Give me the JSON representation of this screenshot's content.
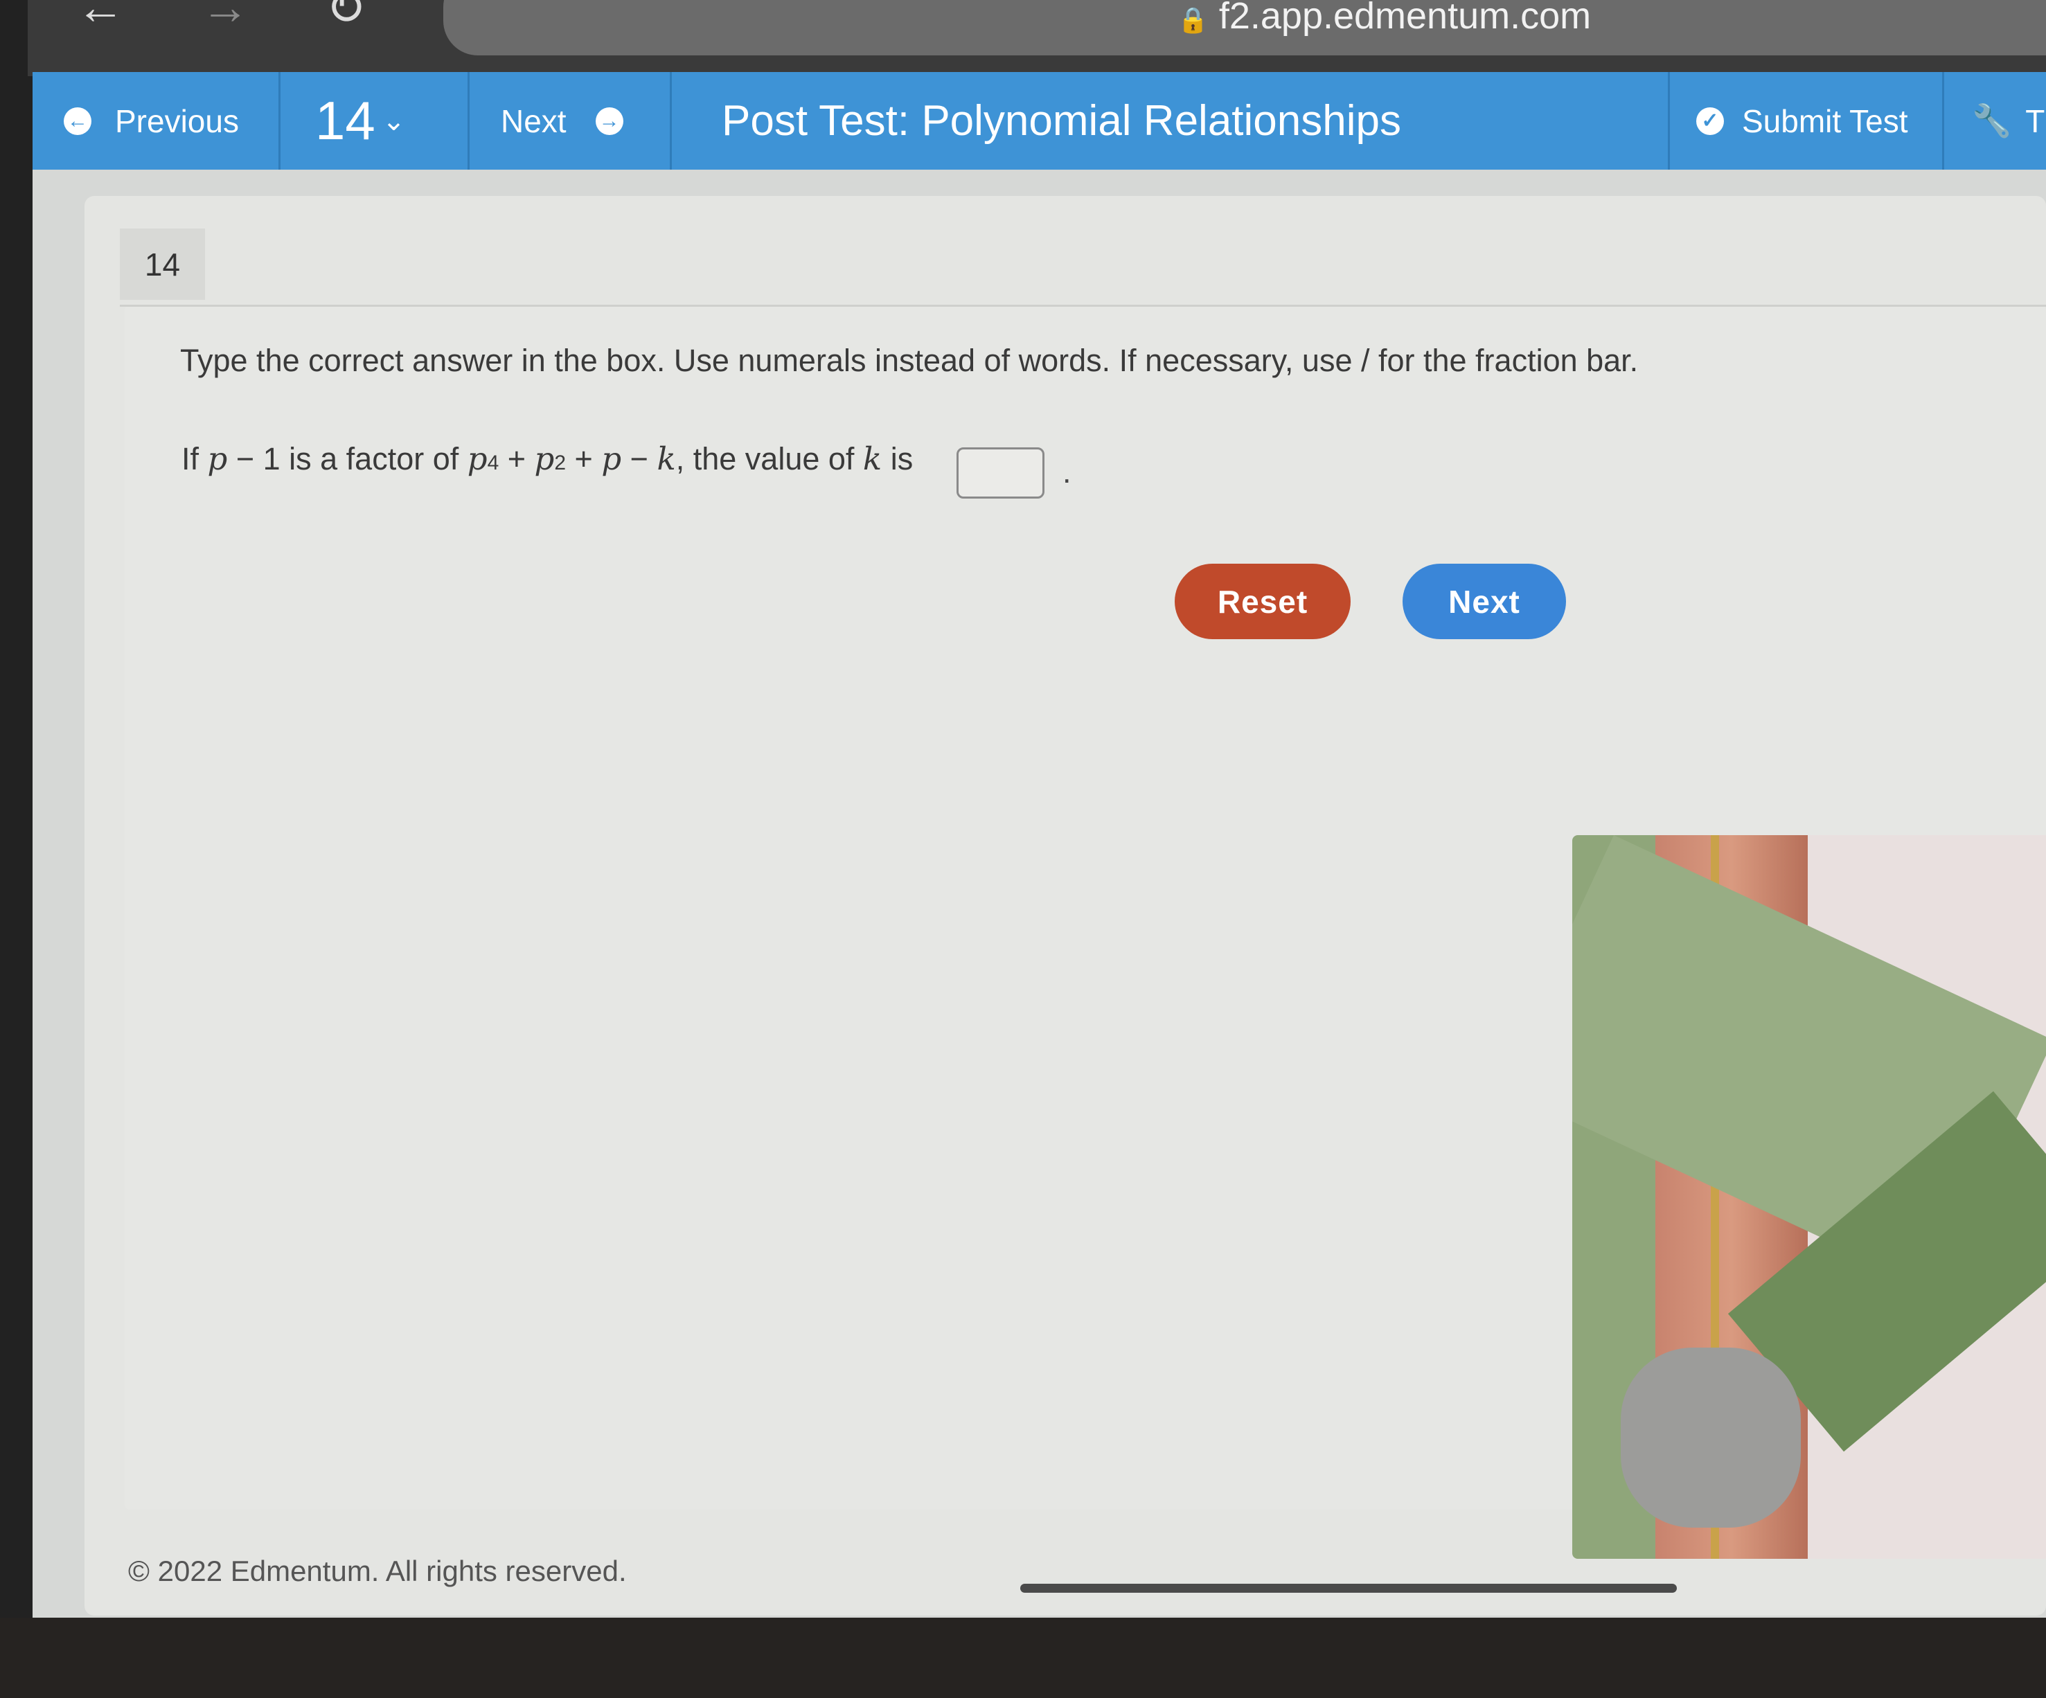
{
  "browser": {
    "url": "f2.app.edmentum.com",
    "back_icon": "arrow-left",
    "forward_icon": "arrow-right",
    "reload_icon": "reload",
    "lock_icon": "lock"
  },
  "navbar": {
    "previous_label": "Previous",
    "question_number": "14",
    "next_label": "Next",
    "title": "Post Test: Polynomial Relationships",
    "submit_label": "Submit Test",
    "tools_label": "T"
  },
  "question": {
    "number": "14",
    "instruction": "Type the correct answer in the box. Use numerals instead of words. If necessary, use / for the fraction bar.",
    "text_if": "If ",
    "var_p": "p",
    "text_minus1": " − 1 is a factor of ",
    "exp4": "4",
    "plus": " + ",
    "exp2": "2",
    "minus": " − ",
    "var_k": "k",
    "text_value": ", the value of ",
    "text_is": " is",
    "answer_value": "",
    "period": "."
  },
  "buttons": {
    "reset": "Reset",
    "next": "Next"
  },
  "footer": {
    "copyright": "© 2022 Edmentum. All rights reserved."
  },
  "colors": {
    "navbar": "#3e93d6",
    "reset": "#c04a2b",
    "next": "#3a86d8"
  }
}
